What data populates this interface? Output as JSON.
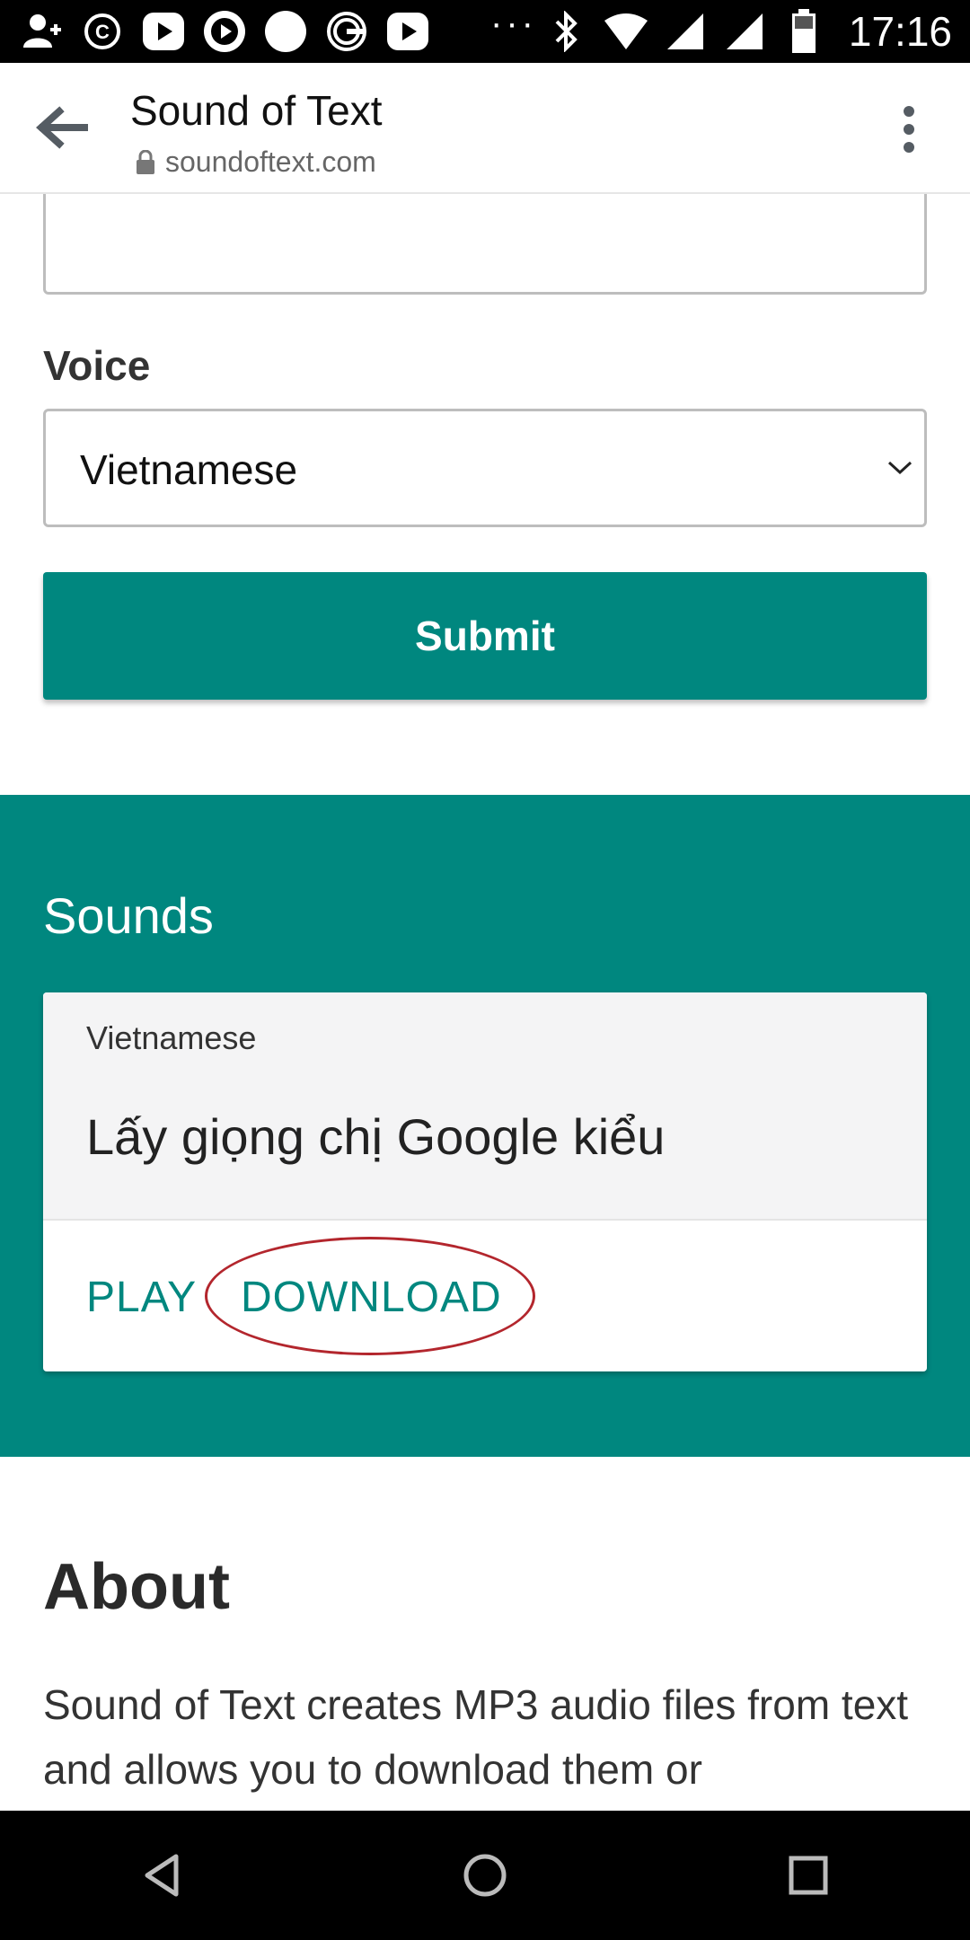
{
  "status_bar": {
    "time": "17:16",
    "icons": [
      "person-add-icon",
      "copyright-icon",
      "play-icon",
      "play-circle-icon",
      "circle-icon",
      "g-icon",
      "play-icon",
      "more-dots",
      "bluetooth-icon",
      "wifi-icon",
      "signal-icon",
      "signal-icon",
      "battery-icon"
    ],
    "dots": "···"
  },
  "app_bar": {
    "title": "Sound of Text",
    "url": "soundoftext.com"
  },
  "form": {
    "voice_label": "Voice",
    "voice_value": "Vietnamese",
    "submit_label": "Submit"
  },
  "sounds": {
    "heading": "Sounds",
    "card": {
      "voice": "Vietnamese",
      "text": "Lấy giọng chị Google kiểu",
      "play_label": "PLAY",
      "download_label": "DOWNLOAD"
    }
  },
  "about": {
    "heading": "About",
    "text": "Sound of Text creates MP3 audio files from text and allows you to download them or"
  },
  "colors": {
    "accent": "#00877f",
    "annotation": "#b3262d"
  }
}
